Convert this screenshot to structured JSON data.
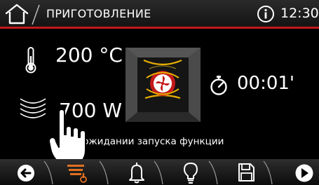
{
  "header": {
    "title": "ПРИГОТОВЛЕНИЕ",
    "time": "12:30",
    "accent_color": "#c41a1a",
    "home_icon": "home-icon",
    "info_icon": "info-icon"
  },
  "main": {
    "temperature": "200 °C",
    "power": "700 W",
    "timer": "00:01'",
    "status": "в ожидании запуска функции",
    "icons": {
      "temperature": "thermometer-icon",
      "power": "microwave-waves-icon",
      "timer": "stopwatch-icon",
      "function": "oven-fan-function-icon",
      "hand": "pointing-hand-icon"
    }
  },
  "bottom_bar": {
    "items": [
      {
        "icon": "back-arrow-icon"
      },
      {
        "icon": "temperature-settings-icon"
      },
      {
        "icon": "bell-icon"
      },
      {
        "icon": "light-bulb-icon"
      },
      {
        "icon": "save-icon"
      },
      {
        "icon": "play-icon"
      }
    ]
  },
  "colors": {
    "accent": "#c41a1a",
    "oven_heat": "#e8b000",
    "orange": "#e07020"
  }
}
